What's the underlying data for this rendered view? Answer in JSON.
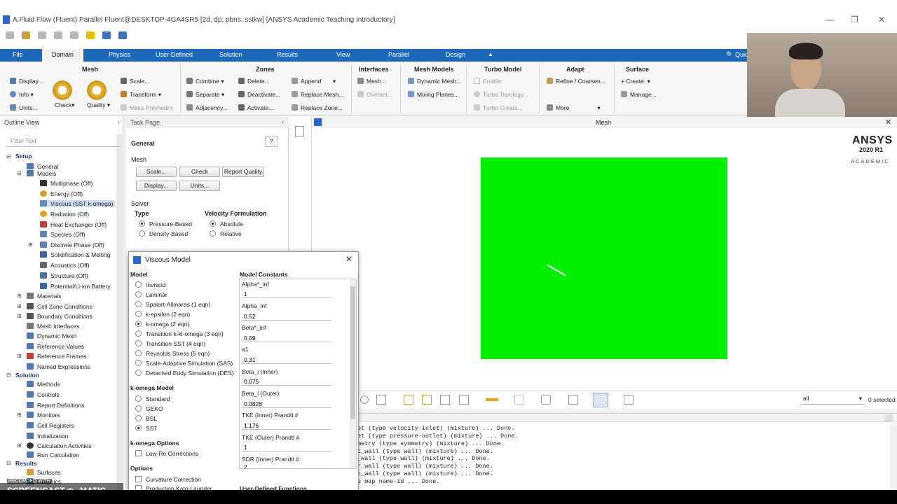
{
  "window": {
    "title": "A:Fluid Flow (Fluent) Parallel Fluent@DESKTOP-4GA4SR5  [2d, dp, pbns, sstkw] [ANSYS Academic Teaching Introductory]"
  },
  "menu": {
    "tabs": [
      "File",
      "Domain",
      "Physics",
      "User-Defined",
      "Solution",
      "Results",
      "View",
      "Parallel",
      "Design"
    ],
    "search_label": "Quick"
  },
  "ribbon": {
    "mesh": {
      "title": "Mesh",
      "display": "Display...",
      "info": "Info",
      "units": "Units...",
      "check": "Check",
      "quality": "Quality",
      "scale": "Scale...",
      "transform": "Transform",
      "make_polyhedra": "Make Polyhedra"
    },
    "zones": {
      "title": "Zones",
      "combine": "Combine",
      "separate": "Separate",
      "adjacency": "Adjacency...",
      "delete": "Delete...",
      "deactivate": "Deactivate...",
      "activate": "Activate...",
      "append": "Append",
      "replace_mesh": "Replace Mesh...",
      "replace_zone": "Replace Zone..."
    },
    "interfaces": {
      "title": "Interfaces",
      "mesh": "Mesh...",
      "overset": "Overset..."
    },
    "mesh_models": {
      "title": "Mesh Models",
      "dynamic_mesh": "Dynamic Mesh...",
      "mixing_planes": "Mixing Planes..."
    },
    "turbo_model": {
      "title": "Turbo Model",
      "enable": "Enable",
      "turbo_topology": "Turbo Topology...",
      "turbo_create": "Turbo Create..."
    },
    "adapt": {
      "title": "Adapt",
      "refine": "Refine / Coarsen...",
      "more": "More"
    },
    "surface": {
      "title": "Surface",
      "create": "Create",
      "manage": "Manage..."
    }
  },
  "outline": {
    "title": "Outline View",
    "filter_placeholder": "Filter Text",
    "setup": "Setup",
    "items": [
      "General",
      "Models",
      "Multiphase (Off)",
      "Energy (Off)",
      "Viscous (SST k-omega)",
      "Radiation (Off)",
      "Heat Exchanger (Off)",
      "Species (Off)",
      "Discrete Phase (Off)",
      "Solidification & Melting",
      "Acoustics (Off)",
      "Structure (Off)",
      "Potential/Li-ion Battery",
      "Materials",
      "Cell Zone Conditions",
      "Boundary Conditions",
      "Mesh Interfaces",
      "Dynamic Mesh",
      "Reference Values",
      "Reference Frames",
      "Named Expressions"
    ],
    "solution": "Solution",
    "solution_items": [
      "Methods",
      "Controls",
      "Report Definitions",
      "Monitors",
      "Cell Registers",
      "Initialization",
      "Calculation Activities",
      "Run Calculation"
    ],
    "results": "Results",
    "results_items": [
      "Surfaces",
      "Graphics"
    ]
  },
  "taskpage": {
    "title": "Task Page",
    "general": "General",
    "mesh": "Mesh",
    "buttons": {
      "scale": "Scale...",
      "check": "Check",
      "report_quality": "Report Quality",
      "display": "Display...",
      "units": "Units..."
    },
    "solver": "Solver",
    "type": "Type",
    "type_options": [
      "Pressure-Based",
      "Density-Based"
    ],
    "velocity_formulation": "Velocity Formulation",
    "velocity_options": [
      "Absolute",
      "Relative"
    ]
  },
  "graphics": {
    "title": "Mesh",
    "ansys": "ANSYS",
    "version": "2020 R1",
    "edition": "ACADEMIC",
    "colors": {
      "domain": "#00ee00"
    }
  },
  "toolbar": {
    "select_value": "all",
    "selected": "0 selected"
  },
  "console": [
    "et (type velocity-inlet) (mixture) ... Done.",
    "et (type pressure-outlet) (mixture) ... Done.",
    "metry (type symmetry) (mixture) ... Done.",
    "t_wall (type wall) (mixture) ... Done.",
    "_wall (type wall) (mixture) ... Done.",
    "r_wall (type wall) (mixture) ... Done.",
    "t_wall (type wall) (mixture) ... Done.",
    "s map name-id ... Done."
  ],
  "dialog": {
    "title": "Viscous Model",
    "model": "Model",
    "models": [
      "Inviscid",
      "Laminar",
      "Spalart-Allmaras (1 eqn)",
      "k-epsilon (2 eqn)",
      "k-omega (2 eqn)",
      "Transition k-kl-omega (3 eqn)",
      "Transition SST (4 eqn)",
      "Reynolds Stress (5 eqn)",
      "Scale-Adaptive Simulation (SAS)",
      "Detached Eddy Simulation (DES)"
    ],
    "kw_model": "k-omega Model",
    "kw_models": [
      "Standard",
      "GEKO",
      "BSL",
      "SST"
    ],
    "kw_options": "k-omega Options",
    "low_re": "Low-Re Corrections",
    "options": "Options",
    "curvature": "Curvature Correction",
    "production": "Production Kato-Launder",
    "constants_title": "Model Constants",
    "constants": [
      {
        "label": "Alpha*_inf",
        "value": "1"
      },
      {
        "label": "Alpha_inf",
        "value": "0.52"
      },
      {
        "label": "Beta*_inf",
        "value": "0.09"
      },
      {
        "label": "a1",
        "value": "0.31"
      },
      {
        "label": "Beta_i (Inner)",
        "value": "0.075"
      },
      {
        "label": "Beta_i (Outer)",
        "value": "0.0828"
      },
      {
        "label": "TKE (Inner) Prandtl #",
        "value": "1.176"
      },
      {
        "label": "TKE (Outer) Prandtl #",
        "value": "1"
      },
      {
        "label": "SDR (Inner) Prandtl #",
        "value": "2"
      }
    ],
    "udf": "User-Defined Functions"
  },
  "watermark": {
    "recorded": "RECORDED WITH",
    "brand": "SCREENCAST",
    "suffix": "MATIC"
  }
}
